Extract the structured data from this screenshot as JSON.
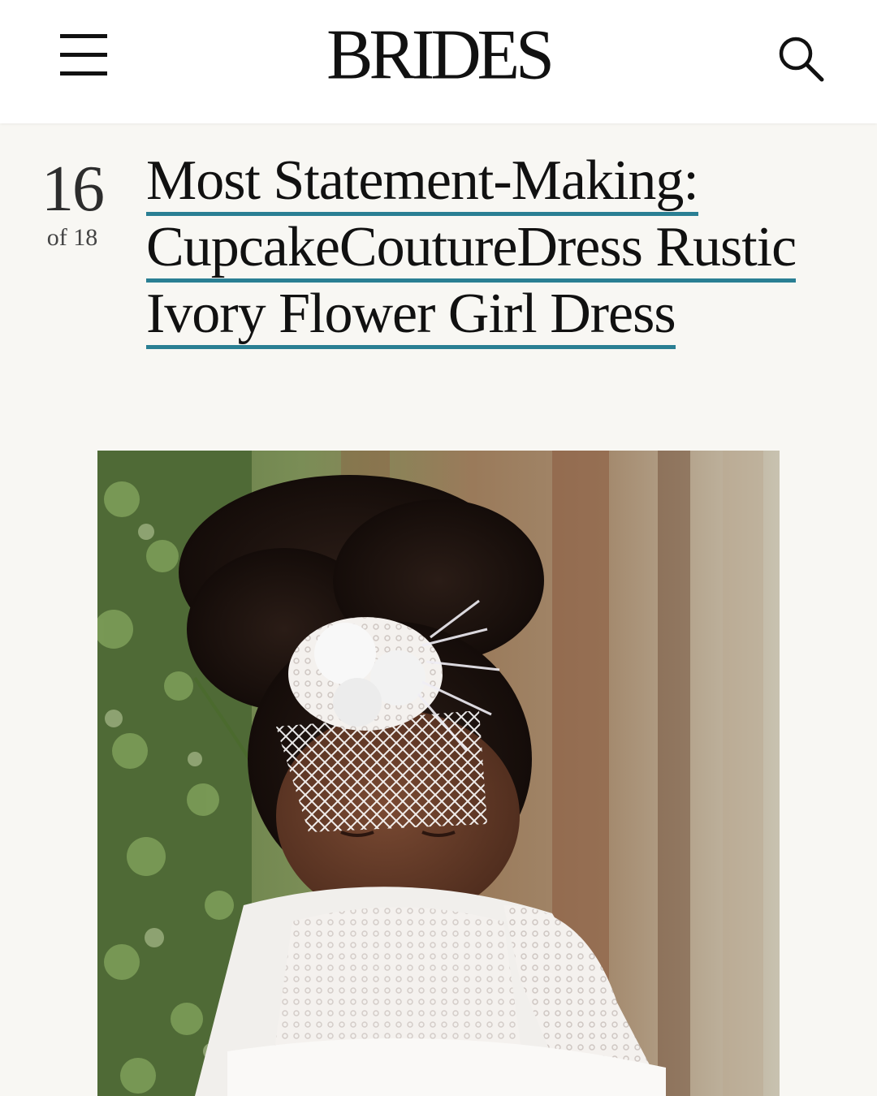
{
  "header": {
    "logo": "BRIDES",
    "menu_icon": "hamburger-menu-icon",
    "search_icon": "search-icon"
  },
  "slide": {
    "number": "16",
    "of_label": "of 18",
    "title": "Most Statement-Making: CupcakeCoutureDress Rustic Ivory Flower Girl Dress",
    "link_color": "#2a7f93"
  },
  "image": {
    "alt": "Flower girl in ivory lace dress with feathered headpiece and birdcage veil"
  }
}
